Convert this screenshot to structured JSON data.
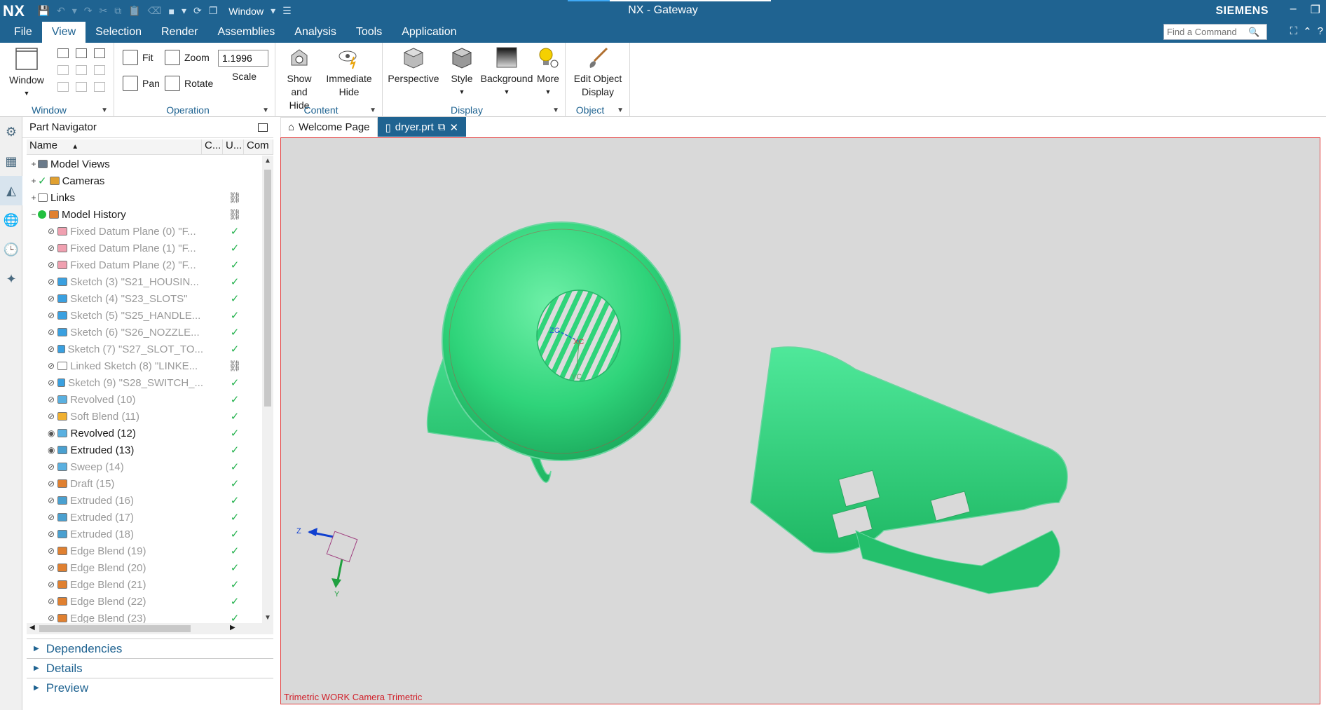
{
  "app": {
    "logo": "NX",
    "window_menu": "Window",
    "title": "NX - Gateway",
    "brand": "SIEMENS"
  },
  "menu": {
    "items": [
      "File",
      "View",
      "Selection",
      "Render",
      "Assemblies",
      "Analysis",
      "Tools",
      "Application"
    ],
    "active": "View"
  },
  "command_search": {
    "placeholder": "Find a Command"
  },
  "ribbon": {
    "window_group": {
      "window_label": "Window",
      "group_label": "Window"
    },
    "operation_group": {
      "fit": "Fit",
      "zoom": "Zoom",
      "pan": "Pan",
      "rotate": "Rotate",
      "scale_value": "1.1996",
      "scale_label": "Scale",
      "group_label": "Operation"
    },
    "content_group": {
      "show_hide": "Show and Hide",
      "immediate_hide": "Immediate Hide",
      "group_label": "Content"
    },
    "display_group": {
      "perspective": "Perspective",
      "style": "Style",
      "background": "Background",
      "more": "More",
      "group_label": "Display"
    },
    "object_group": {
      "edit_object_display": "Edit Object Display",
      "group_label": "Object"
    }
  },
  "navigator": {
    "title": "Part Navigator",
    "columns": [
      "Name",
      "C...",
      "U...",
      "Com"
    ],
    "rows": [
      {
        "expander": "+",
        "name": "Model Views",
        "icon": "views-icon",
        "status": "",
        "gray": false
      },
      {
        "expander": "+",
        "name": "Cameras",
        "icon": "camera-icon",
        "status": "",
        "gray": false
      },
      {
        "expander": "+",
        "name": "Links",
        "icon": "folder-icon",
        "status": "link",
        "gray": false
      },
      {
        "expander": "−",
        "name": "Model History",
        "icon": "history-icon",
        "status": "link",
        "gray": false
      },
      {
        "expander": "",
        "name": "Fixed Datum Plane (0) \"F...",
        "icon": "datum-plane-icon",
        "status": "check",
        "gray": true
      },
      {
        "expander": "",
        "name": "Fixed Datum Plane (1) \"F...",
        "icon": "datum-plane-icon",
        "status": "check",
        "gray": true
      },
      {
        "expander": "",
        "name": "Fixed Datum Plane (2) \"F...",
        "icon": "datum-plane-icon",
        "status": "check",
        "gray": true
      },
      {
        "expander": "",
        "name": "Sketch (3) \"S21_HOUSIN...",
        "icon": "sketch-icon",
        "status": "check",
        "gray": true
      },
      {
        "expander": "",
        "name": "Sketch (4) \"S23_SLOTS\"",
        "icon": "sketch-icon",
        "status": "check",
        "gray": true
      },
      {
        "expander": "",
        "name": "Sketch (5) \"S25_HANDLE...",
        "icon": "sketch-icon",
        "status": "check",
        "gray": true
      },
      {
        "expander": "",
        "name": "Sketch (6) \"S26_NOZZLE...",
        "icon": "sketch-icon",
        "status": "check",
        "gray": true
      },
      {
        "expander": "",
        "name": "Sketch (7) \"S27_SLOT_TO...",
        "icon": "sketch-icon",
        "status": "check",
        "gray": true
      },
      {
        "expander": "",
        "name": "Linked Sketch (8) \"LINKE...",
        "icon": "linked-sketch-icon",
        "status": "link",
        "gray": true
      },
      {
        "expander": "",
        "name": "Sketch (9) \"S28_SWITCH_...",
        "icon": "sketch-icon",
        "status": "check",
        "gray": true
      },
      {
        "expander": "",
        "name": "Revolved (10)",
        "icon": "revolve-icon",
        "status": "check",
        "gray": true
      },
      {
        "expander": "",
        "name": "Soft Blend (11)",
        "icon": "soft-blend-icon",
        "status": "check",
        "gray": true
      },
      {
        "expander": "",
        "name": "Revolved (12)",
        "icon": "revolve-icon",
        "status": "check",
        "gray": false
      },
      {
        "expander": "",
        "name": "Extruded (13)",
        "icon": "extrude-icon",
        "status": "check",
        "gray": false
      },
      {
        "expander": "",
        "name": "Sweep (14)",
        "icon": "sweep-icon",
        "status": "check",
        "gray": true
      },
      {
        "expander": "",
        "name": "Draft (15)",
        "icon": "draft-icon",
        "status": "check",
        "gray": true
      },
      {
        "expander": "",
        "name": "Extruded (16)",
        "icon": "extrude-icon",
        "status": "check",
        "gray": true
      },
      {
        "expander": "",
        "name": "Extruded (17)",
        "icon": "extrude-icon",
        "status": "check",
        "gray": true
      },
      {
        "expander": "",
        "name": "Extruded (18)",
        "icon": "extrude-icon",
        "status": "check",
        "gray": true
      },
      {
        "expander": "",
        "name": "Edge Blend (19)",
        "icon": "edge-blend-icon",
        "status": "check",
        "gray": true
      },
      {
        "expander": "",
        "name": "Edge Blend (20)",
        "icon": "edge-blend-icon",
        "status": "check",
        "gray": true
      },
      {
        "expander": "",
        "name": "Edge Blend (21)",
        "icon": "edge-blend-icon",
        "status": "check",
        "gray": true
      },
      {
        "expander": "",
        "name": "Edge Blend (22)",
        "icon": "edge-blend-icon",
        "status": "check",
        "gray": true
      },
      {
        "expander": "",
        "name": "Edge Blend (23)",
        "icon": "edge-blend-icon",
        "status": "check",
        "gray": true
      }
    ],
    "panels": [
      "Dependencies",
      "Details",
      "Preview"
    ]
  },
  "tabs": [
    {
      "label": "Welcome Page",
      "active": false
    },
    {
      "label": "dryer.prt",
      "active": true
    }
  ],
  "graphics": {
    "view_label": "Trimetric WORK Camera Trimetric",
    "axes": {
      "z": "Z",
      "y": "Y",
      "zc": "ZC",
      "xc": "XC",
      "yc": "YC"
    },
    "model_color": "#2fd47a",
    "border_color": "#e03c3c"
  }
}
